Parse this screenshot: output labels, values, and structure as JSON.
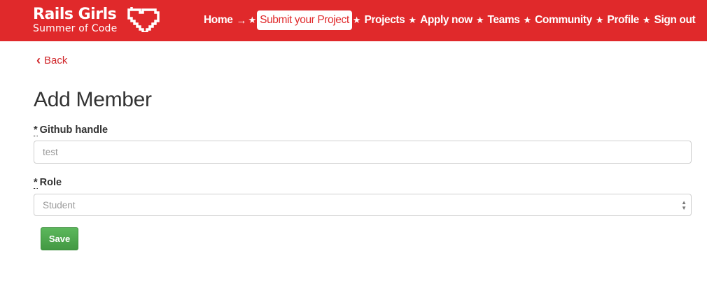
{
  "header": {
    "logo_title": "Rails Girls",
    "logo_subtitle": "Summer of Code",
    "brand_color": "#e0292b",
    "nav": [
      {
        "label": "Home",
        "sep": "→"
      },
      {
        "label": "Submit your Project",
        "sep": "★",
        "active": true
      },
      {
        "label": "Projects",
        "sep": "★"
      },
      {
        "label": "Apply now",
        "sep": "★"
      },
      {
        "label": "Teams",
        "sep": "★"
      },
      {
        "label": "Community",
        "sep": "★"
      },
      {
        "label": "Profile",
        "sep": "★"
      },
      {
        "label": "Sign out",
        "sep": ""
      }
    ]
  },
  "back_link": {
    "icon": "chevron-left-icon",
    "label": "Back"
  },
  "page_title": "Add Member",
  "form": {
    "github": {
      "required_mark": "*",
      "label": "Github handle",
      "value": "test"
    },
    "role": {
      "required_mark": "*",
      "label": "Role",
      "value": "Student"
    },
    "save_label": "Save"
  }
}
